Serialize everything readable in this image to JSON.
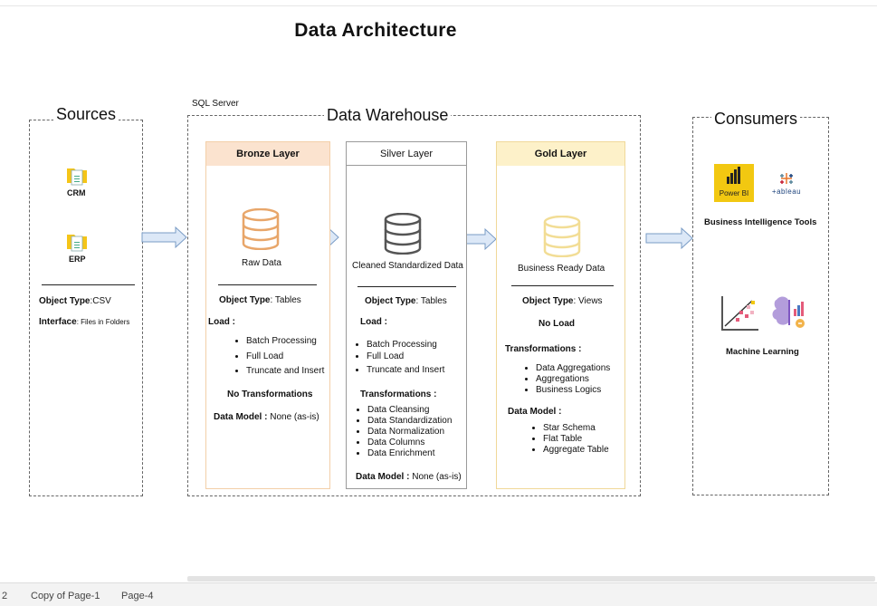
{
  "title": "Data Architecture",
  "sources": {
    "label": "Sources",
    "items": [
      {
        "label": "CRM"
      },
      {
        "label": "ERP"
      }
    ],
    "object_type_label": "Object Type",
    "object_type_value": ":CSV",
    "interface_label": "Interface",
    "interface_value": ": Files in Folders"
  },
  "warehouse": {
    "server_label": "SQL Server",
    "label": "Data Warehouse",
    "bronze": {
      "header": "Bronze Layer",
      "data_label": "Raw Data",
      "object_type_label": "Object Type",
      "object_type_value": ": Tables",
      "load_label": "Load :",
      "load_items": [
        "Batch Processing",
        "Full Load",
        "Truncate and Insert"
      ],
      "transform_text": "No Transformations",
      "model_label": "Data Model :",
      "model_value": " None (as-is)"
    },
    "silver": {
      "header": "Silver Layer",
      "data_label": "Cleaned Standardized Data",
      "object_type_label": "Object Type",
      "object_type_value": ": Tables",
      "load_label": "Load :",
      "load_items": [
        "Batch Processing",
        "Full Load",
        "Truncate and Insert"
      ],
      "transform_label": "Transformations :",
      "transform_items": [
        "Data Cleansing",
        "Data Standardization",
        "Data Normalization",
        "Data Columns",
        "Data Enrichment"
      ],
      "model_label": "Data Model :",
      "model_value": " None (as-is)"
    },
    "gold": {
      "header": "Gold Layer",
      "data_label": "Business Ready Data",
      "object_type_label": "Object Type",
      "object_type_value": ": Views",
      "load_text": "No Load",
      "transform_label": "Transformations :",
      "transform_items": [
        "Data Aggregations",
        "Aggregations",
        "Business Logics"
      ],
      "model_label": "Data Model :",
      "model_items": [
        "Star Schema",
        "Flat Table",
        "Aggregate Table"
      ]
    }
  },
  "consumers": {
    "label": "Consumers",
    "powerbi_text": "Power BI",
    "tableau_text": "+ableau",
    "bi_label": "Business Intelligence Tools",
    "ml_label": "Machine  Learning"
  },
  "footer": {
    "page_number": "2",
    "tabs": [
      "Copy of Page-1",
      "Page-4"
    ]
  },
  "colors": {
    "bronze_header": "#fbe3cf",
    "bronze_border": "#f3cfa8",
    "bronze_icon": "#e8a66a",
    "silver_border": "#9a9a9a",
    "silver_icon": "#555555",
    "gold_header": "#fdf1c9",
    "gold_border": "#f0d899",
    "gold_icon": "#f2dd95",
    "arrow_fill": "#dce8f7",
    "arrow_stroke": "#7a9cc6",
    "powerbi": "#f2c811"
  }
}
